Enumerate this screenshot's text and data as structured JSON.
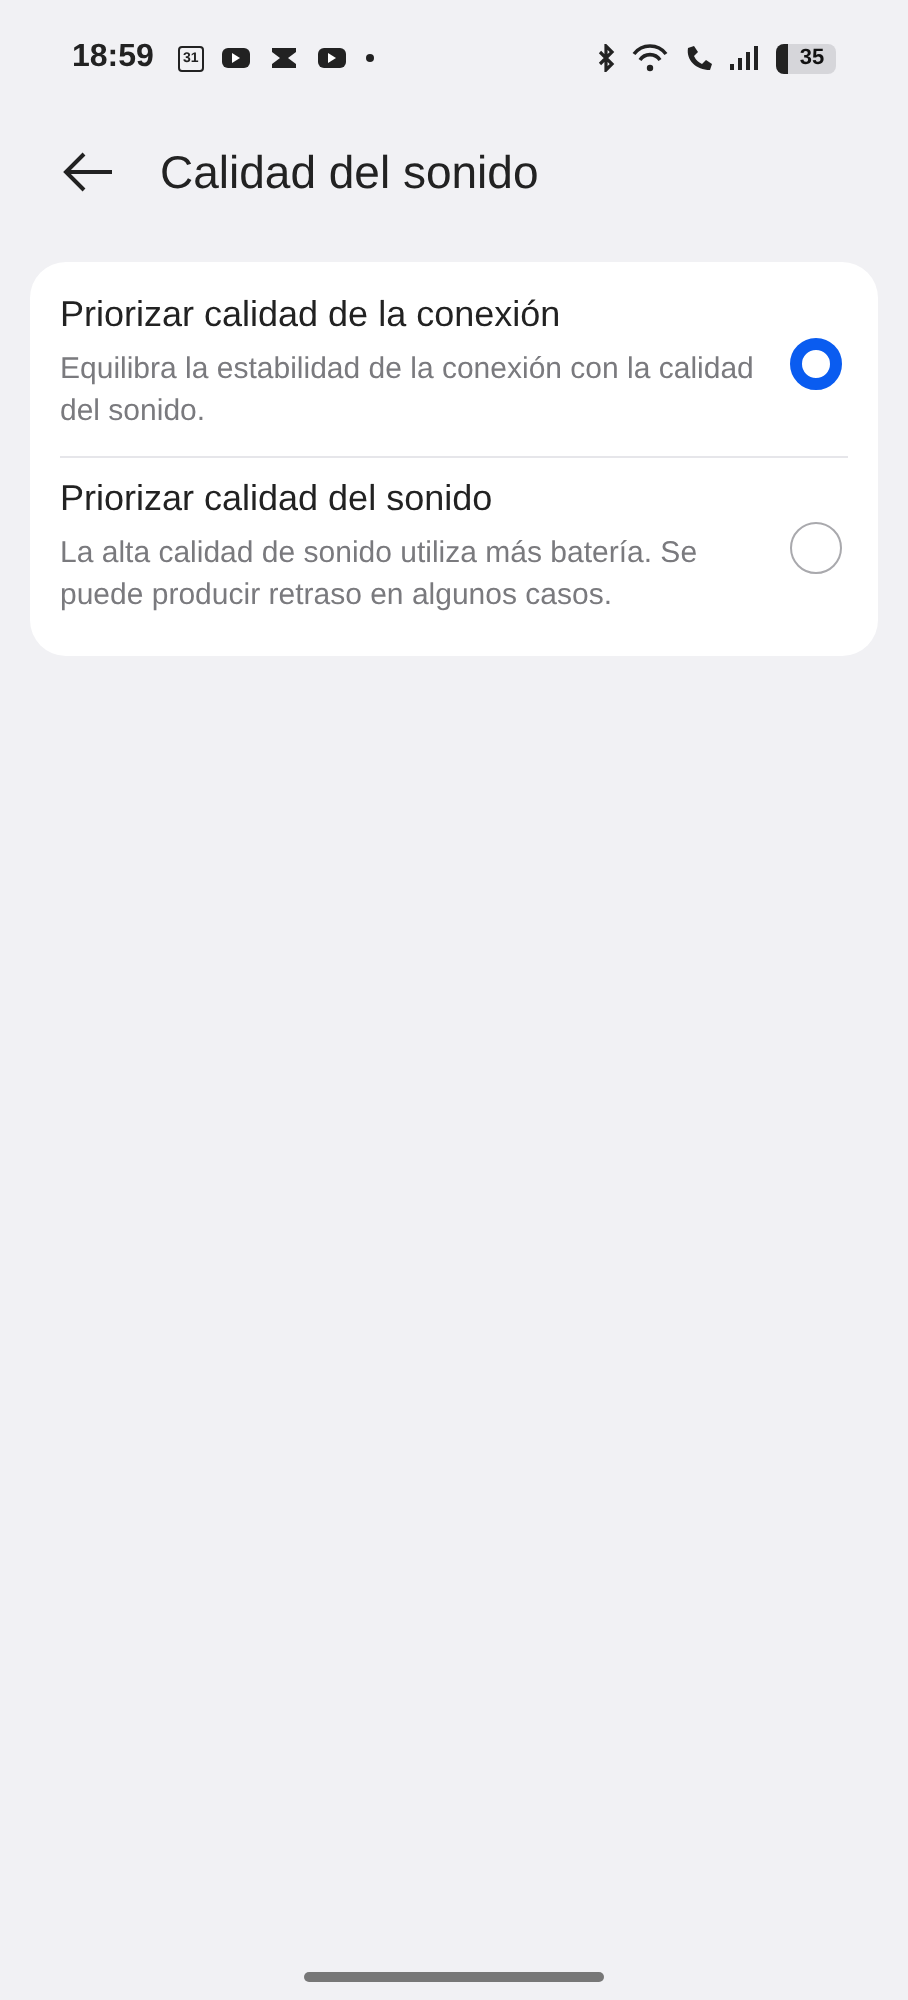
{
  "status_bar": {
    "time": "18:59",
    "calendar_day": "31",
    "battery": "35"
  },
  "header": {
    "title": "Calidad del sonido"
  },
  "options": [
    {
      "title": "Priorizar calidad de la conexión",
      "description": "Equilibra la estabilidad de la conexión con la calidad del sonido.",
      "selected": true
    },
    {
      "title": "Priorizar calidad del sonido",
      "description": "La alta calidad de sonido utiliza más batería. Se puede producir retraso en algunos casos.",
      "selected": false
    }
  ]
}
